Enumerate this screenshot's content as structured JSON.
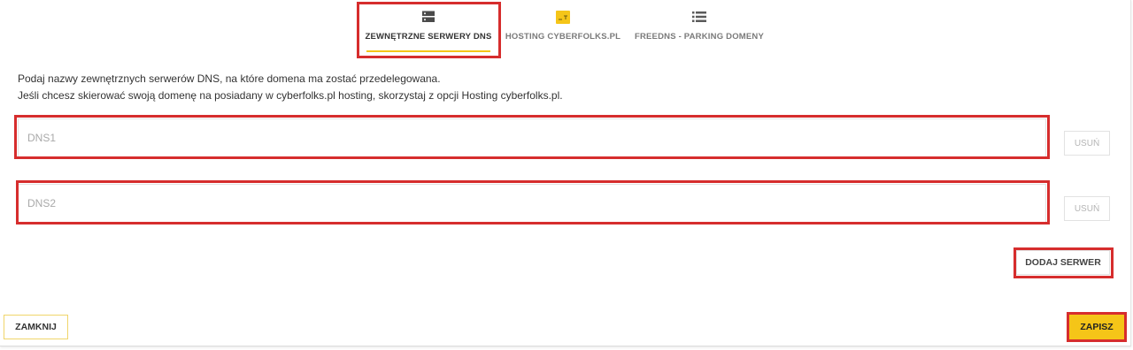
{
  "tabs": [
    {
      "label": "ZEWNĘTRZNE SERWERY DNS",
      "icon": "server-icon",
      "active": true
    },
    {
      "label": "HOSTING CYBERFOLKS.PL",
      "icon": "cyberfolks-logo-icon",
      "active": false
    },
    {
      "label": "FREEDNS - PARKING DOMENY",
      "icon": "list-icon",
      "active": false
    }
  ],
  "description": {
    "line1": "Podaj nazwy zewnętrznych serwerów DNS, na które domena ma zostać przedelegowana.",
    "line2": "Jeśli chcesz skierować swoją domenę na posiadany w cyberfolks.pl hosting, skorzystaj z opcji Hosting cyberfolks.pl."
  },
  "dns_fields": [
    {
      "placeholder": "DNS1",
      "value": "",
      "remove_label": "USUŃ"
    },
    {
      "placeholder": "DNS2",
      "value": "",
      "remove_label": "USUŃ"
    }
  ],
  "add_server_label": "DODAJ SERWER",
  "footer": {
    "close_label": "ZAMKNIJ",
    "save_label": "ZAPISZ"
  },
  "colors": {
    "accent": "#f5c518",
    "highlight": "#d62d2d"
  }
}
